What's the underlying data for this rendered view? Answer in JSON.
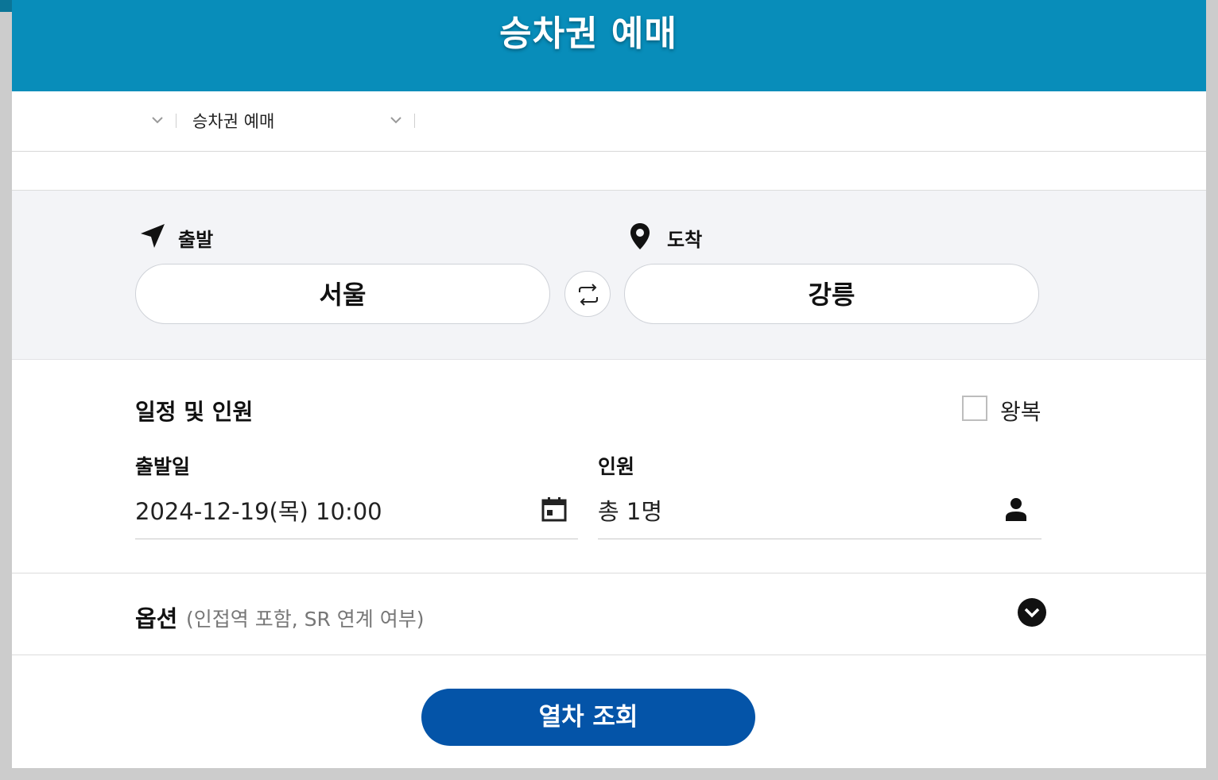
{
  "header": {
    "title": "승차권 예매"
  },
  "breadcrumb": {
    "current": "승차권 예매"
  },
  "stations": {
    "departure_label": "출발",
    "arrival_label": "도착",
    "departure_value": "서울",
    "arrival_value": "강릉"
  },
  "schedule": {
    "title": "일정 및 인원",
    "roundtrip_label": "왕복",
    "roundtrip_checked": false,
    "date_label": "출발일",
    "date_value": "2024-12-19(목) 10:00",
    "people_label": "인원",
    "people_value": "총 1명"
  },
  "options": {
    "title": "옵션",
    "subtitle": "(인접역 포함, SR 연계 여부)"
  },
  "actions": {
    "search_label": "열차 조회"
  },
  "colors": {
    "header_bg": "#088dba",
    "primary_button": "#0454a8",
    "section_bg": "#f3f4f7"
  }
}
